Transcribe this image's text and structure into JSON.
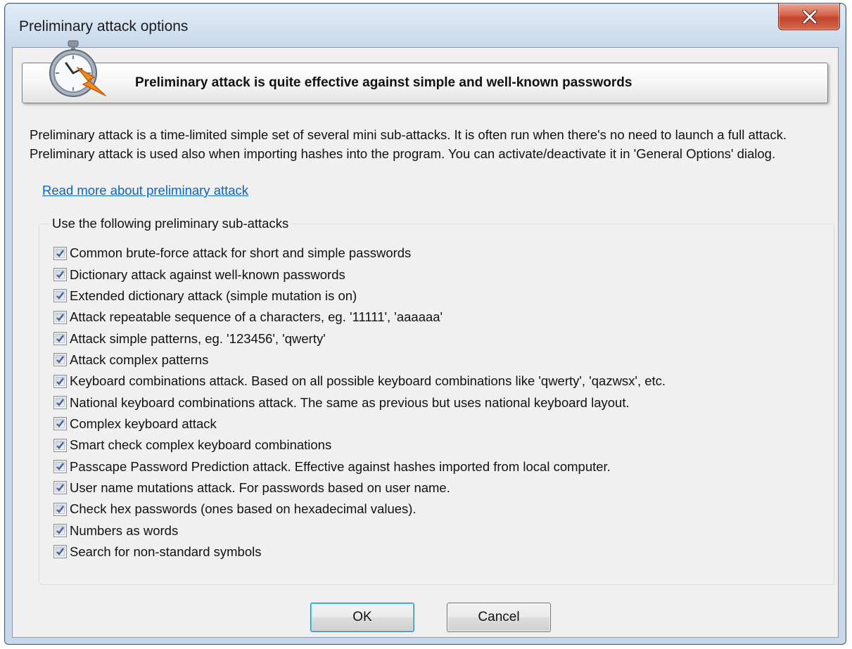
{
  "window": {
    "title": "Preliminary attack options"
  },
  "banner": {
    "text": "Preliminary attack is quite effective against simple and well-known passwords",
    "icon": "stopwatch-lightning-icon"
  },
  "description": "Preliminary attack is a time-limited simple set of several mini sub-attacks. It is often run when there's no need to launch a full attack. Preliminary attack is used also when importing hashes into the program. You can activate/deactivate it in 'General Options' dialog.",
  "link": "Read more about preliminary attack",
  "group": {
    "legend": "Use the following preliminary sub-attacks",
    "options": [
      {
        "label": "Common brute-force attack for short and simple passwords",
        "checked": true
      },
      {
        "label": "Dictionary attack against well-known passwords",
        "checked": true
      },
      {
        "label": "Extended dictionary attack (simple mutation is on)",
        "checked": true
      },
      {
        "label": "Attack repeatable sequence of a characters, eg. '11111', 'aaaaaa'",
        "checked": true
      },
      {
        "label": "Attack simple patterns, eg. '123456', 'qwerty'",
        "checked": true
      },
      {
        "label": "Attack complex patterns",
        "checked": true
      },
      {
        "label": "Keyboard combinations attack. Based on all possible keyboard combinations like 'qwerty', 'qazwsx', etc.",
        "checked": true
      },
      {
        "label": "National keyboard combinations attack. The same as previous but uses national keyboard layout.",
        "checked": true
      },
      {
        "label": "Complex keyboard attack",
        "checked": true
      },
      {
        "label": "Smart check complex keyboard combinations",
        "checked": true
      },
      {
        "label": "Passcape Password Prediction attack. Effective against hashes imported from local computer.",
        "checked": true
      },
      {
        "label": "User name mutations attack. For passwords based on user name.",
        "checked": true
      },
      {
        "label": "Check hex passwords (ones based on hexadecimal values).",
        "checked": true
      },
      {
        "label": "Numbers as words",
        "checked": true
      },
      {
        "label": "Search for non-standard symbols",
        "checked": true
      }
    ]
  },
  "buttons": {
    "ok": "OK",
    "cancel": "Cancel"
  },
  "colors": {
    "link": "#0b63c4",
    "close_button": "#c5432c",
    "check": "#4a5f97"
  }
}
